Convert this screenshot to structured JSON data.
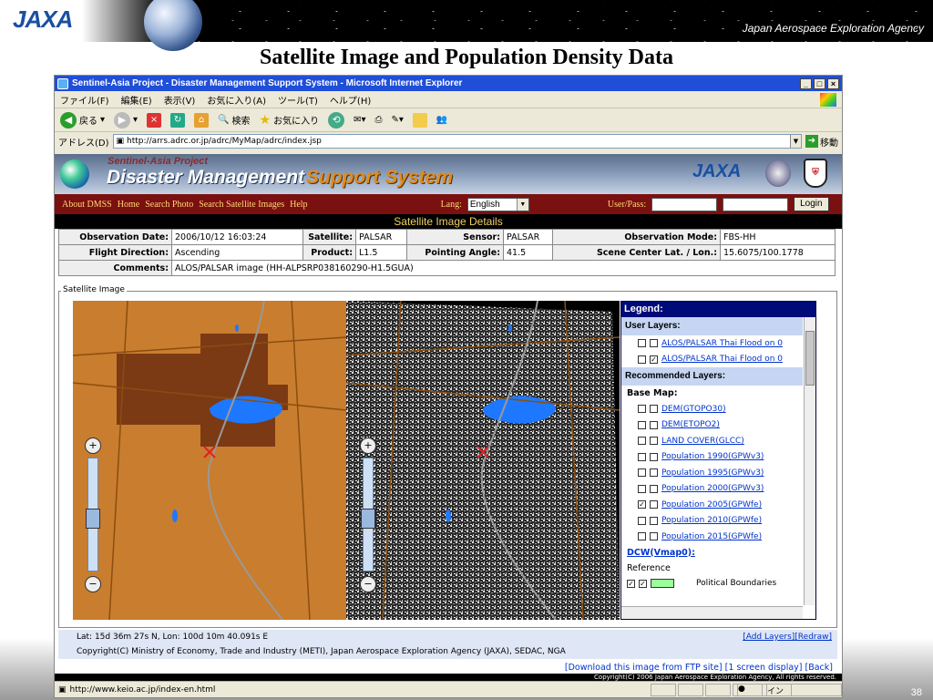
{
  "slide": {
    "logo": "JAXA",
    "agency": "Japan Aerospace Exploration Agency",
    "title": "Satellite Image and Population Density Data",
    "page_number": "38"
  },
  "browser": {
    "window_title": "Sentinel-Asia Project - Disaster Management Support System - Microsoft Internet Explorer",
    "window_buttons": [
      "_",
      "□",
      "×"
    ],
    "menus": [
      "ファイル(F)",
      "編集(E)",
      "表示(V)",
      "お気に入り(A)",
      "ツール(T)",
      "ヘルプ(H)"
    ],
    "toolbar": {
      "back": "戻る",
      "search": "検索",
      "favorites": "お気に入り"
    },
    "address_label": "アドレス(D)",
    "address": "http://arrs.adrc.or.jp/adrc/MyMap/adrc/index.jsp",
    "go": "移動",
    "status_url": "http://www.keio.ac.jp/index-en.html",
    "status_zone": "インターネット"
  },
  "dmss": {
    "subtitle": "Sentinel-Asia Project",
    "title_a": "Disaster Management",
    "title_b": "Support System",
    "jaxa": "JAXA",
    "nav": [
      "About DMSS",
      "Home",
      "Search Photo",
      "Search Satellite Images",
      "Help"
    ],
    "lang_label": "Lang:",
    "lang_value": "English",
    "user_label": "User/Pass:",
    "login": "Login"
  },
  "details": {
    "heading": "Satellite Image Details",
    "observation_date_label": "Observation Date:",
    "observation_date": "2006/10/12 16:03:24",
    "satellite_label": "Satellite:",
    "satellite": "PALSAR",
    "sensor_label": "Sensor:",
    "sensor": "PALSAR",
    "obs_mode_label": "Observation Mode:",
    "obs_mode": "FBS-HH",
    "flight_dir_label": "Flight Direction:",
    "flight_dir": "Ascending",
    "product_label": "Product:",
    "product": "L1.5",
    "pointing_label": "Pointing Angle:",
    "pointing": "41.5",
    "scene_center_label": "Scene Center Lat. / Lon.:",
    "scene_center": "15.6075/100.1778",
    "comments_label": "Comments:",
    "comments": "ALOS/PALSAR image (HH-ALPSRP038160290-H1.5GUA)"
  },
  "map": {
    "frame_label": "Satellite Image",
    "zoom_in": "+",
    "zoom_out": "−",
    "coords": "Lat: 15d 36m 27s N, Lon: 100d 10m 40.091s E",
    "add_layers": "[Add Layers]",
    "redraw": "[Redraw]",
    "copyright": "Copyright(C) Ministry of Economy, Trade and Industry (METI), Japan Aerospace Exploration Agency (JAXA), SEDAC, NGA",
    "download": "[Download this image from FTP site]",
    "one_screen": "[1 screen display]",
    "back": "[Back]",
    "footer_copy": "Copyright(C) 2006 Japan Aerospace Exploration Agency, All rights reserved."
  },
  "legend": {
    "title": "Legend:",
    "user_layers": "User Layers:",
    "user_items": [
      {
        "label": "ALOS/PALSAR Thai Flood on 0",
        "checked": false
      },
      {
        "label": "ALOS/PALSAR Thai Flood on 0",
        "checked": true
      }
    ],
    "recommended": "Recommended Layers:",
    "base_map": "Base Map:",
    "base_items": [
      {
        "label": "DEM(GTOPO30)",
        "checked": false
      },
      {
        "label": "DEM(ETOPO2)",
        "checked": false
      },
      {
        "label": "LAND COVER(GLCC)",
        "checked": false
      },
      {
        "label": "Population 1990(GPWv3)",
        "checked": false
      },
      {
        "label": "Population 1995(GPWv3)",
        "checked": false
      },
      {
        "label": "Population 2000(GPWv3)",
        "checked": false
      },
      {
        "label": "Population 2005(GPWfe)",
        "checked": true
      },
      {
        "label": "Population 2010(GPWfe)",
        "checked": false
      },
      {
        "label": "Population 2015(GPWfe)",
        "checked": false
      }
    ],
    "dcw": "DCW(Vmap0):",
    "reference": "Reference",
    "political": "Political Boundaries"
  }
}
